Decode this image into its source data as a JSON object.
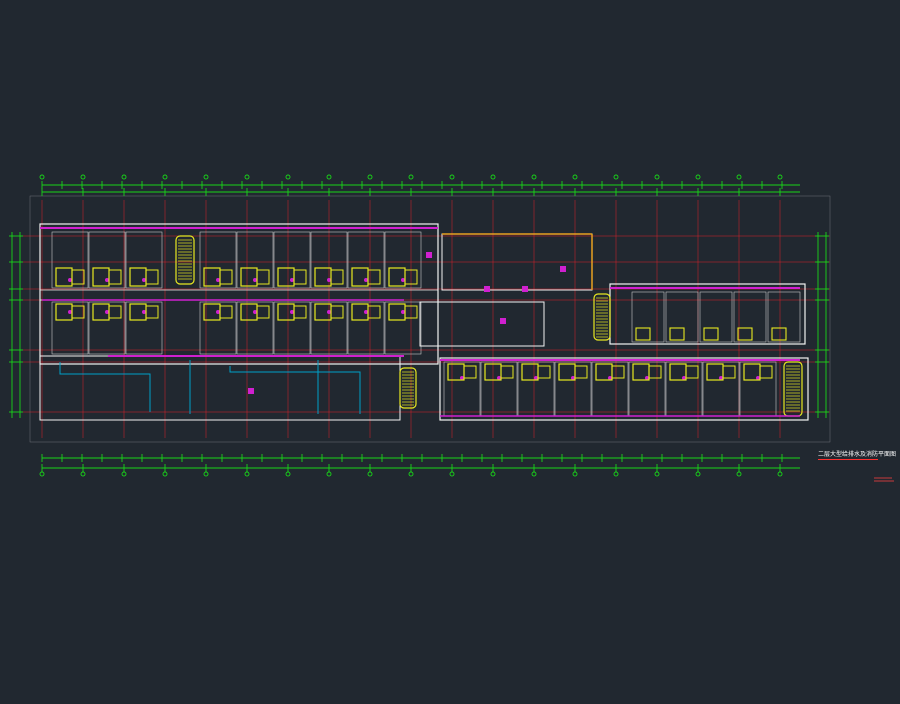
{
  "app": {
    "kind": "cad-viewer",
    "background_color": "#212830"
  },
  "drawing": {
    "title": "二层大型给排水及消防平面图",
    "scale_note": "",
    "layer_colors": {
      "dimension_lines": "#19d419",
      "axis_grid": "#e0202a",
      "walls": "#f2f2f2",
      "fixtures": "#e8e820",
      "water_pipes": "#d020d0",
      "drain_pipes": "#00a0c8",
      "hatching": "#c8c8c8"
    }
  }
}
